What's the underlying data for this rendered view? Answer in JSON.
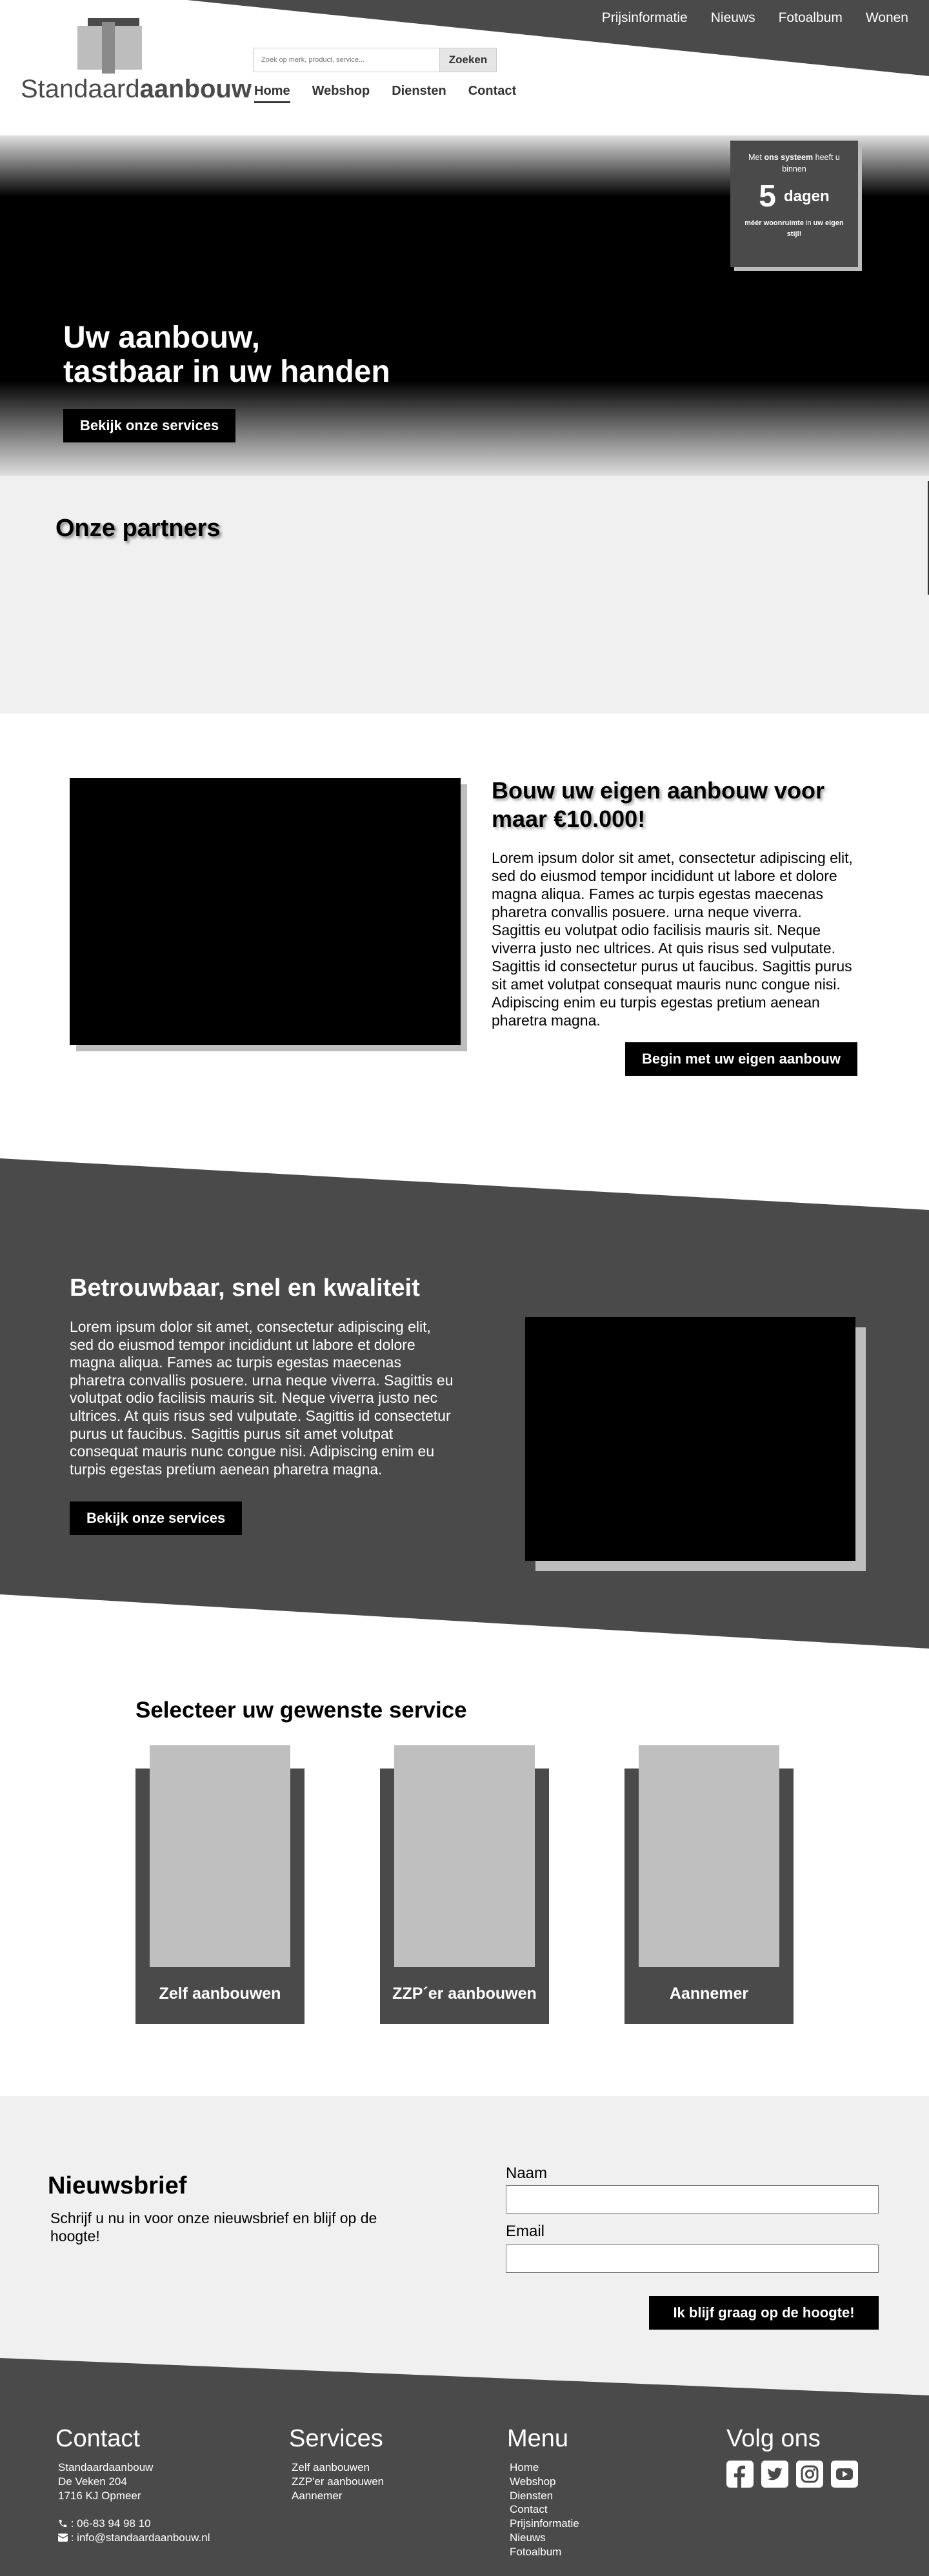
{
  "header": {
    "top_nav": [
      "Prijsinformatie",
      "Nieuws",
      "Fotoalbum",
      "Wonen"
    ],
    "logo": {
      "text_light": "Standaard",
      "text_bold": "aanbouw"
    },
    "search": {
      "placeholder": "Zoek op merk, product, service...",
      "button": "Zoeken"
    },
    "main_nav": [
      "Home",
      "Webshop",
      "Diensten",
      "Contact"
    ]
  },
  "hero": {
    "title_line1": "Uw aanbouw,",
    "title_line2": "tastbaar in uw handen",
    "button": "Bekijk onze services",
    "badge": {
      "pre": "Met ",
      "pre_bold": "ons systeem",
      "pre_after": " heeft u binnen",
      "number": "5",
      "unit": "dagen",
      "post_bold1": "méér woonruimte",
      "post_mid": " in ",
      "post_bold2": "uw eigen stijl!"
    }
  },
  "partners": {
    "title": "Onze partners"
  },
  "build": {
    "title": "Bouw uw eigen aanbouw voor maar €10.000!",
    "text": "Lorem ipsum dolor sit amet, consectetur adipiscing elit, sed do eiusmod tempor incididunt ut labore et dolore magna aliqua. Fames ac turpis egestas maecenas pharetra convallis posuere. urna neque viverra. Sagittis eu volutpat odio facilisis mauris sit. Neque viverra justo nec ultrices. At quis risus sed vulputate. Sagittis id consectetur purus ut faucibus. Sagittis purus sit amet volutpat consequat mauris nunc congue nisi. Adipiscing enim eu turpis egestas pretium aenean pharetra magna.",
    "button": "Begin met uw eigen aanbouw"
  },
  "trust": {
    "title": "Betrouwbaar, snel en kwaliteit",
    "text": "Lorem ipsum dolor sit amet, consectetur adipiscing elit, sed do eiusmod tempor incididunt ut labore et dolore magna aliqua. Fames ac turpis egestas maecenas pharetra convallis posuere. urna neque viverra. Sagittis eu volutpat odio facilisis mauris sit. Neque viverra justo nec ultrices. At quis risus sed vulputate. Sagittis id consectetur purus ut faucibus. Sagittis purus sit amet volutpat consequat mauris nunc congue nisi. Adipiscing enim eu turpis egestas pretium aenean pharetra magna.",
    "button": "Bekijk onze services"
  },
  "services": {
    "title": "Selecteer uw gewenste service",
    "cards": [
      "Zelf aanbouwen",
      "ZZP´er aanbouwen",
      "Aannemer"
    ]
  },
  "newsletter": {
    "title": "Nieuwsbrief",
    "text": "Schrijf u nu in voor onze nieuwsbrief en blijf op de hoogte!",
    "name_label": "Naam",
    "email_label": "Email",
    "button": "Ik blijf graag op de hoogte!"
  },
  "footer": {
    "contact": {
      "title": "Contact",
      "lines": [
        "Standaardaanbouw",
        "De Veken 204",
        "1716 KJ Opmeer"
      ],
      "phone": ": 06-83 94 98 10",
      "email": ": info@standaardaanbouw.nl"
    },
    "services": {
      "title": "Services",
      "items": [
        "Zelf aanbouwen",
        "ZZP'er aanbouwen",
        "Aannemer"
      ]
    },
    "menu": {
      "title": "Menu",
      "items": [
        "Home",
        "Webshop",
        "Diensten",
        "Contact",
        "Prijsinformatie",
        "Nieuws",
        "Fotoalbum"
      ]
    },
    "social": {
      "title": "Volg ons",
      "icons": [
        "facebook-icon",
        "twitter-icon",
        "instagram-icon",
        "youtube-icon"
      ]
    }
  },
  "colors": {
    "dark_grey": "#4a4a4a",
    "light_grey": "#f0f0f0",
    "placeholder_grey": "#bfbfbf",
    "black": "#000000"
  }
}
